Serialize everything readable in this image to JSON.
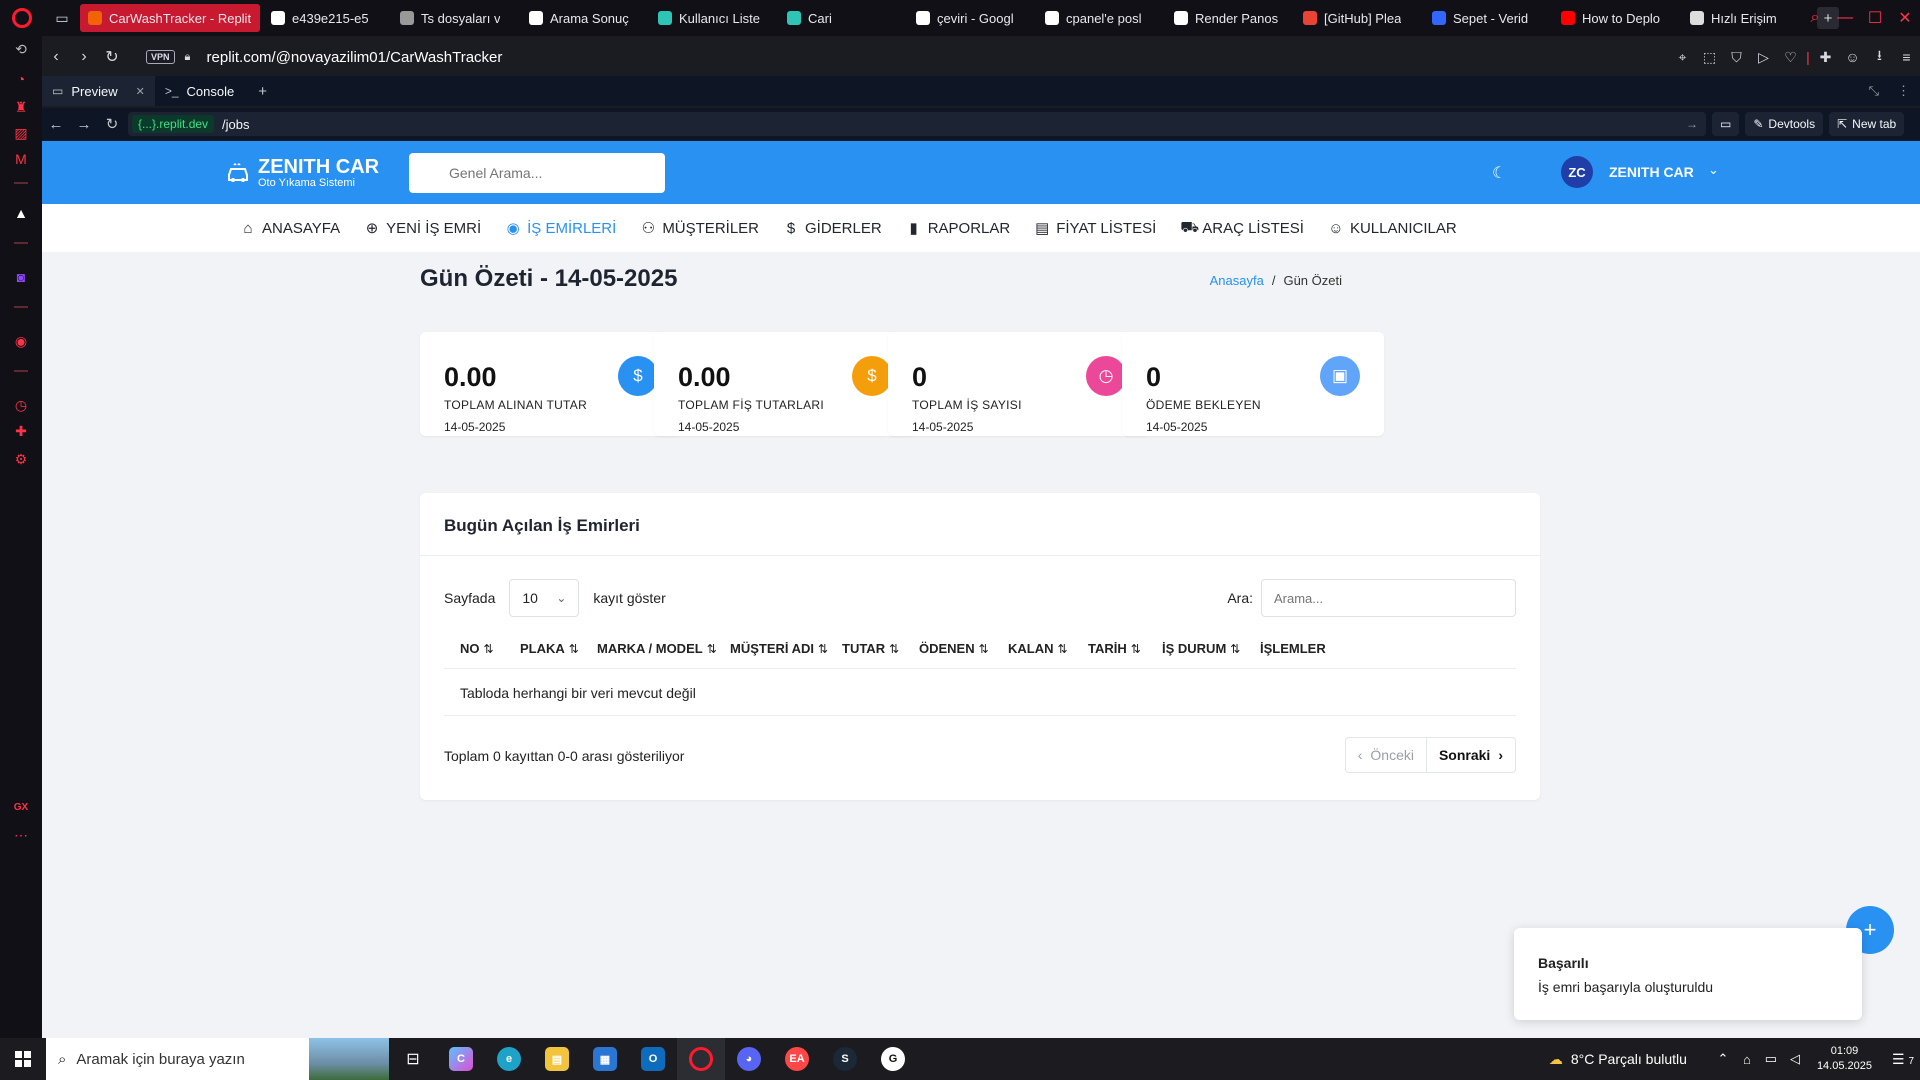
{
  "browser": {
    "tabs": [
      {
        "label": "CarWashTracker - Replit",
        "color": "#f26207",
        "active": true
      },
      {
        "label": "e439e215-e5",
        "color": "#ffffff"
      },
      {
        "label": "Ts dosyaları v",
        "color": "#999999"
      },
      {
        "label": "Arama Sonuç",
        "color": "#ffffff"
      },
      {
        "label": "Kullanıcı Liste",
        "color": "#2ec4b6"
      },
      {
        "label": "Cari",
        "color": "#2ec4b6"
      },
      {
        "label": "çeviri - Googl",
        "color": "#ffffff"
      },
      {
        "label": "cpanel'e posl",
        "color": "#ffffff"
      },
      {
        "label": "Render Panos",
        "color": "#ffffff"
      },
      {
        "label": "[GitHub] Plea",
        "color": "#ea4335"
      },
      {
        "label": "Sepet - Verid",
        "color": "#3366ff"
      },
      {
        "label": "How to Deplo",
        "color": "#ff0000"
      },
      {
        "label": "Hızlı Erişim",
        "color": "#dddddd"
      }
    ],
    "vpn_badge": "VPN",
    "url": "replit.com/@novayazilim01/CarWashTracker"
  },
  "replit": {
    "tabs": [
      {
        "label": "Preview",
        "active": true
      },
      {
        "label": "Console",
        "active": false
      }
    ],
    "host_chip": "{...}.replit.dev",
    "path": "/jobs",
    "devtools_label": "Devtools",
    "newtab_label": "New tab"
  },
  "app": {
    "brand": {
      "name": "ZENITH CAR",
      "subtitle": "Oto Yıkama Sistemi"
    },
    "search_placeholder": "Genel Arama...",
    "user": {
      "initials": "ZC",
      "name": "ZENITH CAR"
    },
    "nav": [
      {
        "label": "ANASAYFA",
        "icon": "home-icon",
        "active": false
      },
      {
        "label": "YENİ İŞ EMRİ",
        "icon": "plus-circle-icon",
        "active": false
      },
      {
        "label": "İŞ EMİRLERİ",
        "icon": "eye-icon",
        "active": true
      },
      {
        "label": "MÜŞTERİLER",
        "icon": "users-icon",
        "active": false
      },
      {
        "label": "GİDERLER",
        "icon": "dollar-icon",
        "active": false
      },
      {
        "label": "RAPORLAR",
        "icon": "bar-chart-icon",
        "active": false
      },
      {
        "label": "FİYAT LİSTESİ",
        "icon": "document-icon",
        "active": false
      },
      {
        "label": "ARAÇ LİSTESİ",
        "icon": "car-icon",
        "active": false
      },
      {
        "label": "KULLANICILAR",
        "icon": "user-icon",
        "active": false
      }
    ],
    "page_title": "Gün Özeti - 14-05-2025",
    "breadcrumb": {
      "home": "Anasayfa",
      "separator": "/",
      "current": "Gün Özeti"
    },
    "stats": [
      {
        "value": "0.00",
        "label": "TOPLAM ALINAN TUTAR",
        "date": "14-05-2025",
        "color": "#2891f2",
        "icon": "money-icon"
      },
      {
        "value": "0.00",
        "label": "TOPLAM FİŞ TUTARLARI",
        "date": "14-05-2025",
        "color": "#f59e0b",
        "icon": "receipt-icon"
      },
      {
        "value": "0",
        "label": "TOPLAM İŞ SAYISI",
        "date": "14-05-2025",
        "color": "#ec4899",
        "icon": "clock-icon"
      },
      {
        "value": "0",
        "label": "ÖDEME BEKLEYEN",
        "date": "14-05-2025",
        "color": "#60a5fa",
        "icon": "wallet-icon"
      }
    ],
    "table": {
      "title": "Bugün Açılan İş Emirleri",
      "length_prefix": "Sayfada",
      "length_value": "10",
      "length_suffix": "kayıt göster",
      "search_label": "Ara:",
      "search_placeholder": "Arama...",
      "columns": [
        "NO",
        "PLAKA",
        "MARKA / MODEL",
        "MÜŞTERİ ADI",
        "TUTAR",
        "ÖDENEN",
        "KALAN",
        "TARİH",
        "İŞ DURUM",
        "İŞLEMLER"
      ],
      "empty_text": "Tabloda herhangi bir veri mevcut değil",
      "info": "Toplam 0 kayıttan 0-0 arası gösteriliyor",
      "prev_label": "Önceki",
      "next_label": "Sonraki"
    },
    "toast": {
      "title": "Başarılı",
      "message": "İş emri başarıyla oluşturuldu"
    }
  },
  "taskbar": {
    "search_placeholder": "Aramak için buraya yazın",
    "weather": "8°C  Parçalı bulutlu",
    "time": "01:09",
    "date": "14.05.2025",
    "notifications": "7"
  }
}
